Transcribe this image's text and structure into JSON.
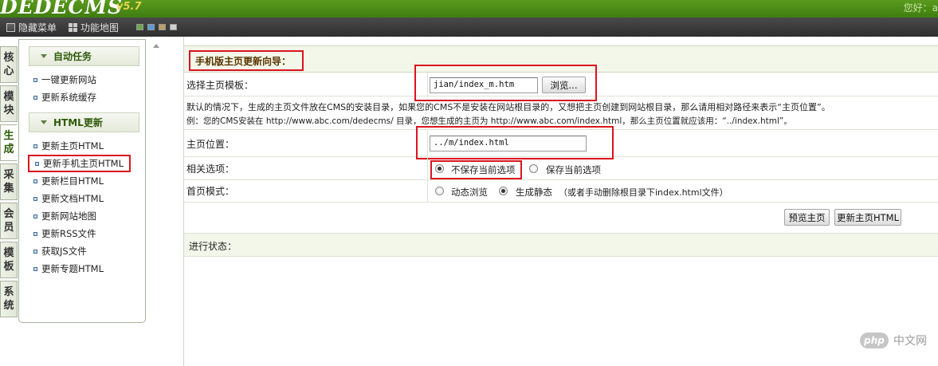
{
  "header": {
    "logo": "DEDECMS",
    "version": "v5.7",
    "greeting": "您好：a"
  },
  "menubar": {
    "hide_menu": "隐藏菜单",
    "site_map": "功能地图",
    "skin_colors": [
      "#6aa84f",
      "#5b9bd5",
      "#b8a06a",
      "#d0d0d0"
    ]
  },
  "vtabs": [
    {
      "chars": [
        "核",
        "心"
      ]
    },
    {
      "chars": [
        "模",
        "块"
      ]
    },
    {
      "chars": [
        "生",
        "成"
      ]
    },
    {
      "chars": [
        "采",
        "集"
      ]
    },
    {
      "chars": [
        "会",
        "员"
      ]
    },
    {
      "chars": [
        "模",
        "板"
      ]
    },
    {
      "chars": [
        "系",
        "统"
      ]
    }
  ],
  "sidebar": {
    "group1_title": "自动任务",
    "group1_items": [
      "一键更新网站",
      "更新系统缓存"
    ],
    "group2_title": "HTML更新",
    "group2_items": [
      "更新主页HTML",
      "更新手机主页HTML",
      "更新栏目HTML",
      "更新文档HTML",
      "更新网站地图",
      "更新RSS文件",
      "获取JS文件",
      "更新专题HTML"
    ]
  },
  "form": {
    "title": "手机版主页更新向导：",
    "template_label": "选择主页模板：",
    "template_value": "jian/index_m.htm",
    "browse_button": "浏览...",
    "note_line1": "默认的情况下，生成的主页文件放在CMS的安装目录，如果您的CMS不是安装在网站根目录的，又想把主页创建到网站根目录，那么请用相对路径来表示“主页位置”。",
    "note_line2": "例：您的CMS安装在 http://www.abc.com/dedecms/ 目录，您想生成的主页为 http://www.abc.com/index.html，那么主页位置就应该用：“../index.html”。",
    "position_label": "主页位置：",
    "position_value": "../m/index.html",
    "options_label": "相关选项：",
    "option_nosave": "不保存当前选项",
    "option_save": "保存当前选项",
    "mode_label": "首页模式：",
    "mode_dynamic": "动态浏览",
    "mode_static": "生成静态",
    "mode_static_note": "（或者手动删除根目录下index.html文件）",
    "preview_button": "预览主页",
    "update_button": "更新主页HTML",
    "status_label": "进行状态："
  },
  "watermark": {
    "badge": "php",
    "text": "中文网"
  }
}
